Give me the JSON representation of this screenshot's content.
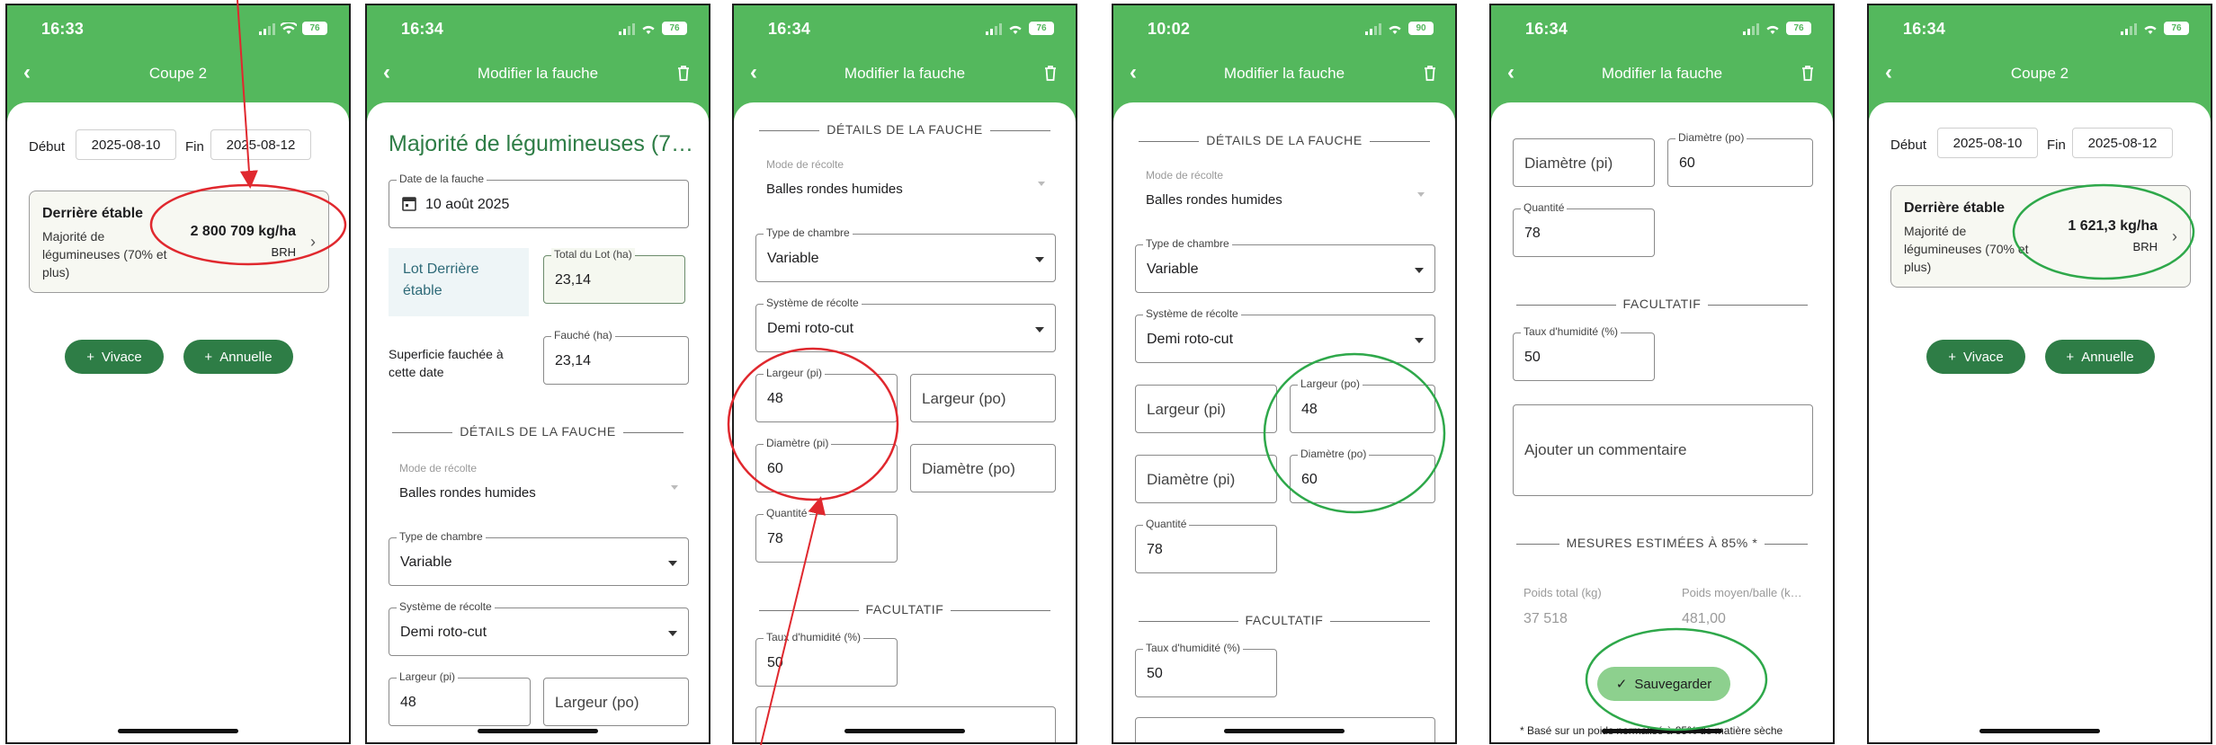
{
  "status": {
    "signal_label": "signal",
    "battery_76": "76",
    "battery_90": "90"
  },
  "screens": [
    {
      "time": "16:33",
      "title": "Coupe 2"
    },
    {
      "time": "16:34",
      "title": "Modifier la fauche"
    },
    {
      "time": "16:34",
      "title": "Modifier la fauche"
    },
    {
      "time": "10:02",
      "title": "Modifier la fauche"
    },
    {
      "time": "16:34",
      "title": "Modifier la fauche"
    },
    {
      "time": "16:34",
      "title": "Coupe 2"
    }
  ],
  "coupe": {
    "debut_label": "Début",
    "debut_value": "2025-08-10",
    "fin_label": "Fin",
    "fin_value": "2025-08-12",
    "card_title": "Derrière étable",
    "card_sub": "Majorité de légumineuses (70% et plus)",
    "card_value_before": "2 800 709 kg/ha",
    "card_value_after": "1 621,3 kg/ha",
    "card_unit": "BRH",
    "btn_vivace": "Vivace",
    "btn_annuelle": "Annuelle"
  },
  "form": {
    "header_title": "Majorité de légumineuses (7…",
    "date_label": "Date de la fauche",
    "date_value": "10 août 2025",
    "lot_label": "Lot Derrière étable",
    "total_label": "Total du Lot (ha)",
    "total_value": "23,14",
    "fauchee_label": "Superficie fauchée à cette date",
    "fauche_label": "Fauché (ha)",
    "fauche_value": "23,14",
    "section_details": "DÉTAILS DE LA FAUCHE",
    "mode_label": "Mode de récolte",
    "mode_value": "Balles rondes humides",
    "chambre_label": "Type de chambre",
    "chambre_value": "Variable",
    "systeme_label": "Système de récolte",
    "systeme_value": "Demi roto-cut",
    "largeur_pi_label": "Largeur (pi)",
    "largeur_po_label": "Largeur (po)",
    "diametre_pi_label": "Diamètre (pi)",
    "diametre_po_label": "Diamètre (po)",
    "value_48": "48",
    "value_60": "60",
    "quantite_label": "Quantité",
    "quantite_value": "78",
    "section_facultatif": "FACULTATIF",
    "humidite_label": "Taux d'humidité (%)",
    "humidite_value": "50",
    "comment_placeholder": "Ajouter un commentaire",
    "section_mesures": "MESURES ESTIMÉES À 85% *",
    "poids_total_label": "Poids total (kg)",
    "poids_total_value": "37 518",
    "poids_moyen_label": "Poids moyen/balle (k…",
    "poids_moyen_value": "481,00",
    "save_label": "Sauvegarder",
    "footnote": "* Basé sur un poids normalisé à 85% de matière sèche"
  },
  "colors": {
    "header_green": "#54b85d",
    "button_green": "#2e7d46",
    "save_green": "#8dd08e",
    "annotation_red": "#e0282e",
    "annotation_green": "#2ea84a"
  }
}
